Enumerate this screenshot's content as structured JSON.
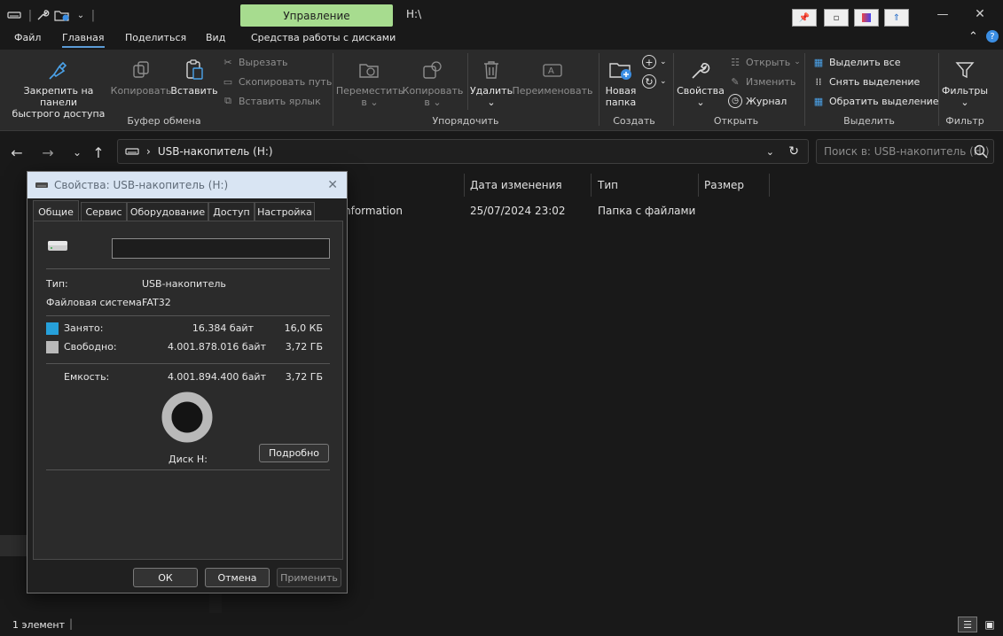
{
  "titlebar": {
    "manage_tab": "Управление",
    "path": "H:\\",
    "minimize": "—",
    "maximize": "☐",
    "close": "✕"
  },
  "tabs": [
    "Файл",
    "Главная",
    "Поделиться",
    "Вид",
    "Средства работы с дисками"
  ],
  "ribbon": {
    "clipboard": {
      "pin_label_1": "Закрепить на панели",
      "pin_label_2": "быстрого доступа",
      "copy": "Копировать",
      "paste": "Вставить",
      "cut": "Вырезать",
      "copy_path": "Скопировать путь",
      "paste_shortcut": "Вставить ярлык",
      "group": "Буфер обмена"
    },
    "organize": {
      "move_1": "Переместить",
      "move_2": "в",
      "copy_to_1": "Копировать",
      "copy_to_2": "в",
      "delete": "Удалить",
      "rename": "Переименовать",
      "group": "Упорядочить"
    },
    "create": {
      "new_folder_1": "Новая",
      "new_folder_2": "папка",
      "group": "Создать"
    },
    "open": {
      "properties": "Свойства",
      "open": "Открыть",
      "edit": "Изменить",
      "history": "Журнал",
      "group": "Открыть"
    },
    "select": {
      "select_all": "Выделить все",
      "select_none": "Снять выделение",
      "invert": "Обратить выделение",
      "group": "Выделить"
    },
    "filter": {
      "filters": "Фильтры",
      "group": "Фильтр"
    }
  },
  "address": {
    "location": "USB-накопитель (H:)",
    "search_placeholder": "Поиск в: USB-накопитель (H:)"
  },
  "columns": [
    "Дата изменения",
    "Тип",
    "Размер"
  ],
  "rows": [
    {
      "name": "nformation",
      "date": "25/07/2024 23:02",
      "type": "Папка с файлами"
    }
  ],
  "status": {
    "count": "1 элемент"
  },
  "dialog": {
    "title": "Свойства: USB-накопитель (H:)",
    "tabs": [
      "Общие",
      "Сервис",
      "Оборудование",
      "Доступ",
      "Настройка"
    ],
    "name_value": "",
    "type_label": "Тип:",
    "type_value": "USB-накопитель",
    "fs_label": "Файловая система:",
    "fs_value": "FAT32",
    "used_label": "Занято:",
    "used_bytes": "16.384 байт",
    "used_size": "16,0 КБ",
    "free_label": "Свободно:",
    "free_bytes": "4.001.878.016 байт",
    "free_size": "3,72 ГБ",
    "capacity_label": "Емкость:",
    "capacity_bytes": "4.001.894.400 байт",
    "capacity_size": "3,72 ГБ",
    "disk_label": "Диск H:",
    "details_button": "Подробно",
    "ok": "ОК",
    "cancel": "Отмена",
    "apply": "Применить",
    "used_fraction": 4e-06,
    "colors": {
      "used": "#26a0da",
      "free": "#b9b9b9"
    }
  }
}
